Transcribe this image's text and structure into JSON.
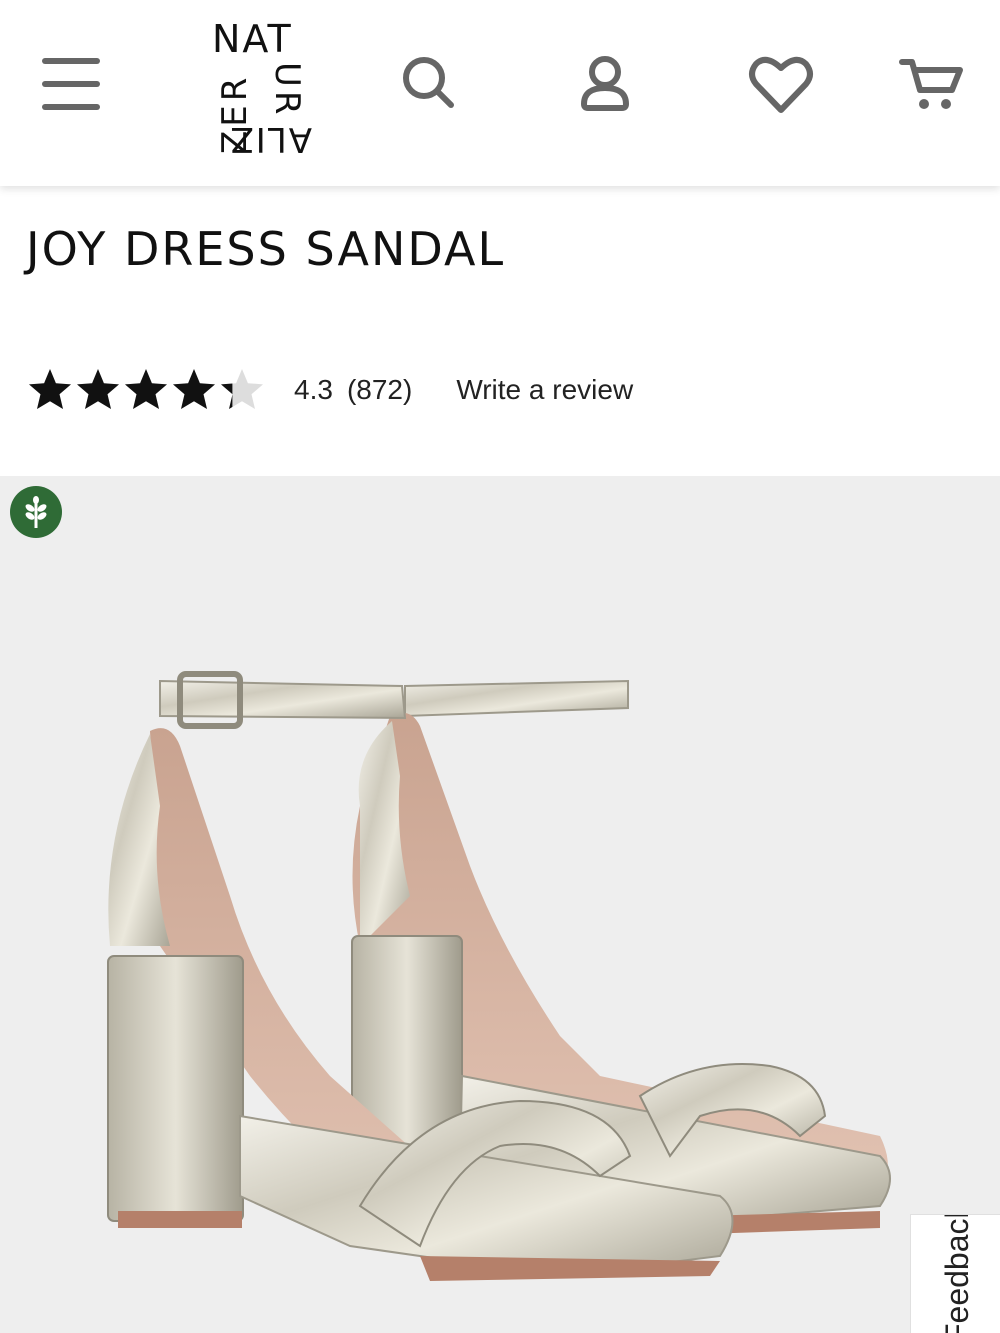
{
  "header": {
    "logo": {
      "top": "NAT",
      "left": "ZER",
      "right": "UR",
      "bottom": "ALIZ"
    },
    "icons": {
      "menu": "hamburger-icon",
      "search": "search-icon",
      "account": "account-icon",
      "wishlist": "heart-icon",
      "cart": "cart-icon"
    }
  },
  "product": {
    "title": "JOY DRESS SANDAL",
    "rating": {
      "stars": 4.3,
      "max_stars": 5,
      "value": "4.3",
      "count": "(872)",
      "write_review": "Write a review"
    },
    "badge_icon": "leaf-eco-icon"
  },
  "feedback": {
    "label": "Feedback"
  },
  "colors": {
    "header_icon": "#666666",
    "text": "#111111",
    "image_bg": "#eeeeee",
    "badge": "#2f6b36",
    "star_filled": "#111111",
    "star_empty": "#dddddd"
  }
}
